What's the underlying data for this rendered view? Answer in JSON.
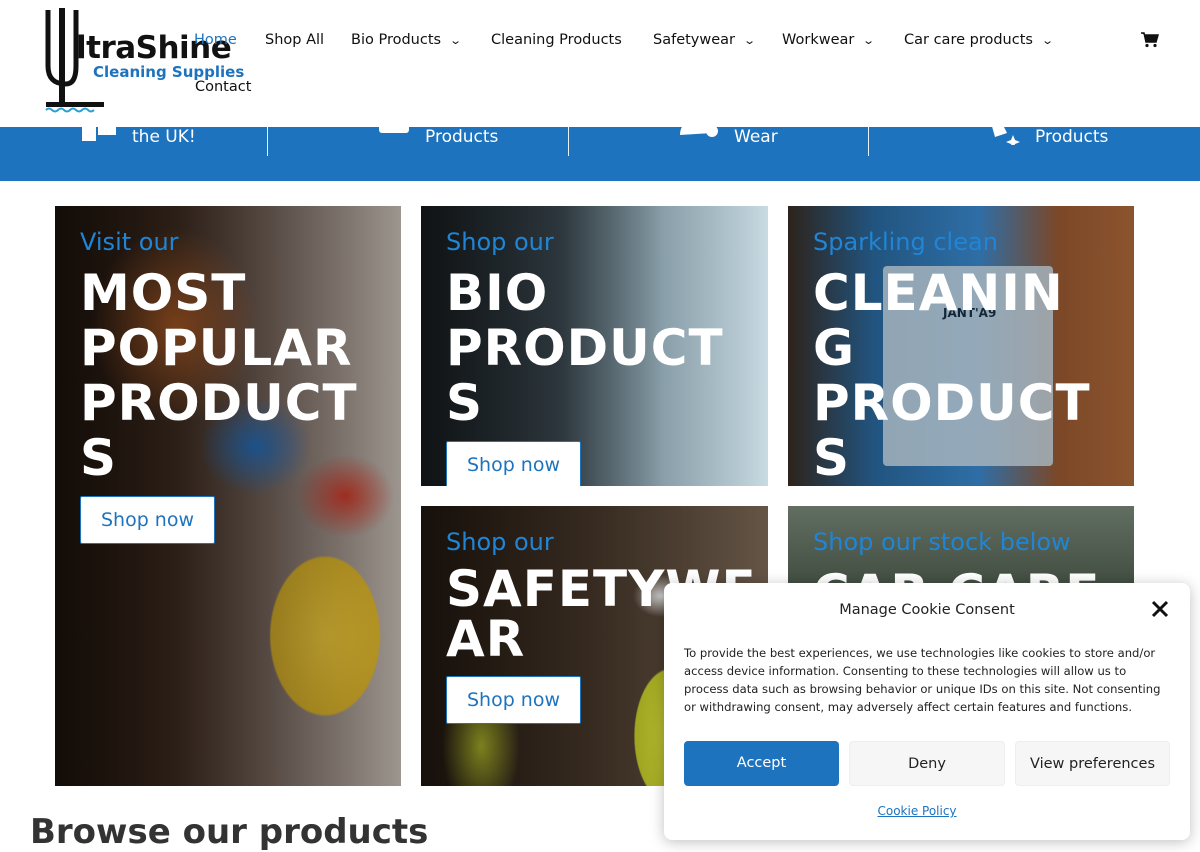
{
  "brand": {
    "name_line1": "ltraShine",
    "name_line2": "Cleaning Supplies"
  },
  "nav": {
    "home": "Home",
    "shop_all": "Shop All",
    "bio": "Bio Products",
    "cleaning": "Cleaning Products",
    "safetywear": "Safetywear",
    "workwear": "Workwear",
    "car_care": "Car care products",
    "contact": "Contact"
  },
  "band": {
    "items": [
      "the UK!",
      "Products",
      "Wear",
      "Products"
    ]
  },
  "cards": [
    {
      "kicker": "Visit our",
      "title_lines": [
        "MOST",
        "POPULAR",
        "PRODUCT",
        "S"
      ],
      "button": "Shop now"
    },
    {
      "kicker": "Shop our",
      "title_lines": [
        "BIO",
        "PRODUCT",
        "S"
      ],
      "button": "Shop now"
    },
    {
      "kicker": "Sparkling clean",
      "title_lines": [
        "CLEANIN",
        "G",
        "PRODUCT",
        "S"
      ],
      "button": ""
    },
    {
      "kicker": "Shop our",
      "title_lines": [
        "SAFETYWE",
        "AR"
      ],
      "button": "Shop now"
    },
    {
      "kicker": "Shop our stock below",
      "title_lines": [
        "CAR CARE"
      ],
      "button": ""
    }
  ],
  "product_label": {
    "line1": "JANT'A9"
  },
  "browse_heading": "Browse our products",
  "cookie": {
    "title": "Manage Cookie Consent",
    "text": "To provide the best experiences, we use technologies like cookies to store and/or access device information. Consenting to these technologies will allow us to process data such as browsing behavior or unique IDs on this site. Not consenting or withdrawing consent, may adversely affect certain features and functions.",
    "accept": "Accept",
    "deny": "Deny",
    "view_preferences": "View preferences",
    "policy_link": "Cookie Policy"
  },
  "colors": {
    "accent": "#1e73be",
    "kicker": "#2185d5"
  },
  "icons": [
    "logo-squeegee-icon",
    "cart-icon",
    "chevron-down-icon",
    "close-icon"
  ]
}
